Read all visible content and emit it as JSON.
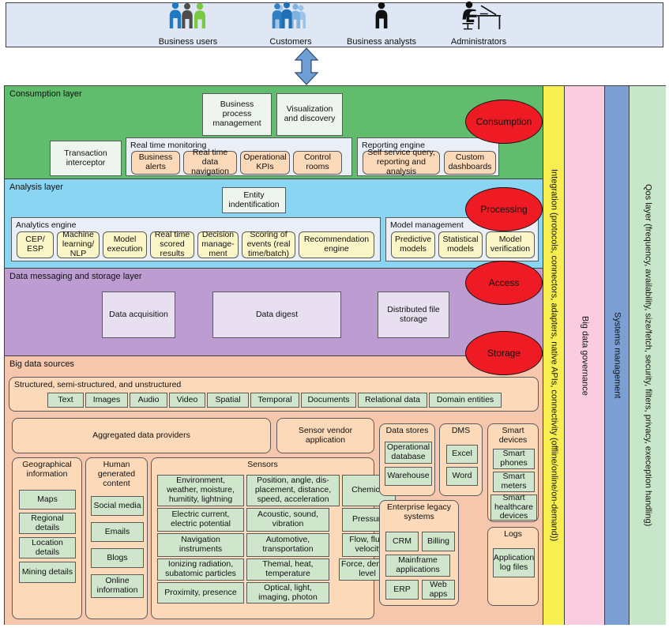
{
  "actors": [
    {
      "name": "Business users",
      "icon": "three-people-icon"
    },
    {
      "name": "Customers",
      "icon": "crowd-people-icon"
    },
    {
      "name": "Business analysts",
      "icon": "single-person-icon"
    },
    {
      "name": "Administrators",
      "icon": "person-at-desk-icon"
    }
  ],
  "arrow": {
    "icon": "double-headed-vertical-arrow-icon"
  },
  "layers": {
    "consumption": {
      "title": "Consumption layer",
      "badge": "Consumption",
      "top_boxes": [
        "Business process management",
        "Visualization and discovery"
      ],
      "transaction_interceptor": "Transaction interceptor",
      "real_time_monitoring": {
        "title": "Real time monitoring",
        "items": [
          "Business alerts",
          "Real time data navigation",
          "Operational KPIs",
          "Control rooms"
        ]
      },
      "reporting_engine": {
        "title": "Reporting engine",
        "items": [
          "Self service query, reporting and analysis",
          "Custom dashboards"
        ]
      }
    },
    "analysis": {
      "title": "Analysis layer",
      "badge": "Processing",
      "entity_identification": "Entity indentification",
      "analytics_engine": {
        "title": "Analytics engine",
        "items": [
          "CEP/ ESP",
          "Machine learning/ NLP",
          "Model execution",
          "Real time scored results",
          "Decision manage- ment",
          "Scoring of events (real time/batch)",
          "Recommendation engine"
        ]
      },
      "model_management": {
        "title": "Model management",
        "items": [
          "Predictive models",
          "Statistical models",
          "Model verification"
        ]
      }
    },
    "messaging": {
      "title": "Data messaging and storage layer",
      "badge": "Access",
      "items": [
        "Data acquisition",
        "Data digest",
        "Distributed file storage"
      ]
    },
    "sources": {
      "title": "Big data sources",
      "badge": "Storage",
      "structured": {
        "title": "Structured, semi-structured, and unstructured",
        "items": [
          "Text",
          "Images",
          "Audio",
          "Video",
          "Spatial",
          "Temporal",
          "Documents",
          "Relational data",
          "Domain entities"
        ]
      },
      "aggregated": "Aggregated data providers",
      "sensor_vendor": "Sensor vendor application",
      "geographical": {
        "title": "Geographical information",
        "items": [
          "Maps",
          "Regional details",
          "Location details",
          "Mining details"
        ]
      },
      "human_generated": {
        "title": "Human generated content",
        "items": [
          "Social media",
          "Emails",
          "Blogs",
          "Online information"
        ]
      },
      "sensors": {
        "title": "Sensors",
        "col1": [
          "Environment, weather, moisture, humitity, lightning",
          "Electric current, electric potential",
          "Navigation instruments",
          "Ionizing radiation, subatomic particles",
          "Proximity, presence"
        ],
        "col2": [
          "Position, angle, dis-placement, distance, speed, acceleration",
          "Acoustic, sound, vibration",
          "Automotive, transportation",
          "Themal, heat, temperature",
          "Optical, light, imaging, photon"
        ],
        "col3": [
          "Chemical",
          "Pressure",
          "Flow, fluid, velocity",
          "Force, density level"
        ]
      },
      "data_stores": {
        "title": "Data stores",
        "items": [
          "Operational database",
          "Warehouse"
        ]
      },
      "dms": {
        "title": "DMS",
        "items": [
          "Excel",
          "Word"
        ]
      },
      "smart_devices": {
        "title": "Smart devices",
        "items": [
          "Smart phones",
          "Smart meters",
          "Smart healthcare devices"
        ]
      },
      "enterprise_legacy": {
        "title": "Enterprise legacy systems",
        "items": [
          "CRM",
          "Billing",
          "Mainframe applications",
          "ERP",
          "Web apps"
        ]
      },
      "logs": {
        "title": "Logs",
        "items": [
          "Application log files"
        ]
      }
    }
  },
  "side_columns": [
    {
      "label": "Integration (protocols, connectors, adapters, native APIs, connectivity (offline/online/on-demand))",
      "color": "#f9ee4f"
    },
    {
      "label": "Big data governance",
      "color": "#f9ccdf"
    },
    {
      "label": "Systems management",
      "color": "#7c9fd4"
    },
    {
      "label": "Qos layer (frequency, availability, size/fetch, security, filters, privacy, exeception handling)",
      "color": "#c8e6c9"
    }
  ]
}
